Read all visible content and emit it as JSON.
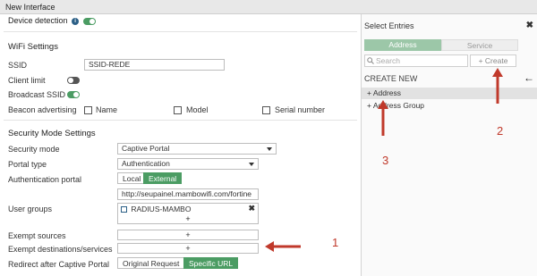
{
  "window": {
    "title": "New Interface"
  },
  "top": {
    "device_detection_label": "Device detection",
    "device_detection_on": true
  },
  "wifi": {
    "section_title": "WiFi Settings",
    "ssid_label": "SSID",
    "ssid_value": "SSID-REDE",
    "client_limit_label": "Client limit",
    "broadcast_ssid_label": "Broadcast SSID",
    "beacon_label": "Beacon advertising",
    "beacon_options": [
      "Name",
      "Model",
      "Serial number"
    ]
  },
  "security": {
    "section_title": "Security Mode Settings",
    "mode_label": "Security mode",
    "mode_value": "Captive Portal",
    "portal_type_label": "Portal type",
    "portal_type_value": "Authentication",
    "auth_portal_label": "Authentication portal",
    "auth_portal_options": [
      "Local",
      "External"
    ],
    "auth_portal_selected": "External",
    "auth_portal_url": "http://seupainel.mambowifi.com/fortine",
    "user_groups_label": "User groups",
    "user_group_item": "RADIUS-MAMBO",
    "plus": "+",
    "exempt_sources_label": "Exempt sources",
    "exempt_dest_label": "Exempt destinations/services",
    "redirect_label": "Redirect after Captive Portal",
    "redirect_options": [
      "Original Request",
      "Specific URL"
    ],
    "redirect_selected": "Specific URL"
  },
  "annotations": {
    "n1": "1",
    "n2": "2",
    "n3": "3",
    "color": "#c0392b"
  },
  "panel": {
    "title": "Select Entries",
    "close": "✖",
    "tabs": [
      "Address",
      "Service"
    ],
    "active_tab": "Address",
    "search_placeholder": "Search",
    "create_label": "+ Create",
    "create_new_label": "CREATE NEW",
    "back_arrow": "←",
    "entries": [
      "+ Address",
      "+ Address Group"
    ]
  },
  "colors": {
    "accent": "#4b9c63",
    "tab_active": "#9cc7a8",
    "arrow_red": "#c0392b"
  }
}
